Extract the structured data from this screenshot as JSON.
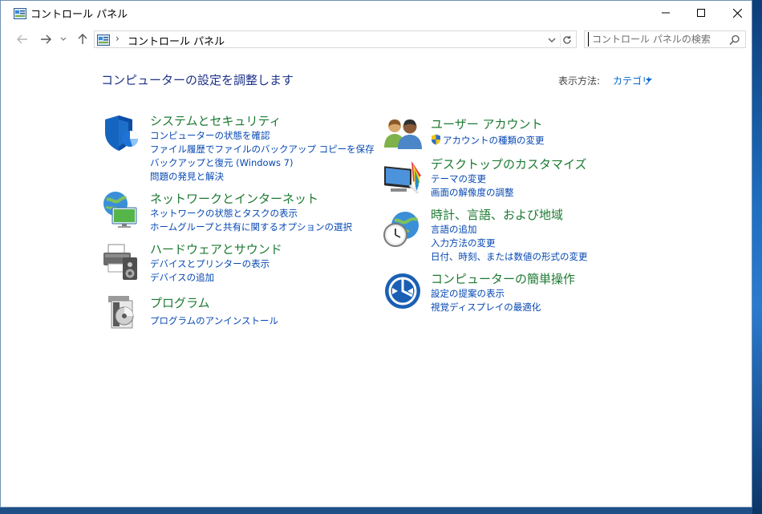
{
  "window": {
    "title": "コントロール パネル"
  },
  "address_bar": {
    "separator": "›",
    "path": "コントロール パネル"
  },
  "search": {
    "placeholder": "コントロール パネルの検索"
  },
  "content": {
    "title": "コンピューターの設定を調整します",
    "view_by_label": "表示方法:",
    "view_by_value": "カテゴリ"
  },
  "categories_left": [
    {
      "title": "システムとセキュリティ",
      "icon": "shield-icon",
      "links": [
        "コンピューターの状態を確認",
        "ファイル履歴でファイルのバックアップ コピーを保存",
        "バックアップと復元 (Windows 7)",
        "問題の発見と解決"
      ]
    },
    {
      "title": "ネットワークとインターネット",
      "icon": "network-globe-icon",
      "links": [
        "ネットワークの状態とタスクの表示",
        "ホームグループと共有に関するオプションの選択"
      ]
    },
    {
      "title": "ハードウェアとサウンド",
      "icon": "printer-speaker-icon",
      "links": [
        "デバイスとプリンターの表示",
        "デバイスの追加"
      ]
    },
    {
      "title": "プログラム",
      "icon": "program-disc-icon",
      "links": [
        "プログラムのアンインストール"
      ]
    }
  ],
  "categories_right": [
    {
      "title": "ユーザー アカウント",
      "icon": "users-icon",
      "links": [
        "アカウントの種類の変更"
      ]
    },
    {
      "title": "デスクトップのカスタマイズ",
      "icon": "monitor-palette-icon",
      "links": [
        "テーマの変更",
        "画面の解像度の調整"
      ]
    },
    {
      "title": "時計、言語、および地域",
      "icon": "clock-globe-icon",
      "links": [
        "言語の追加",
        "入力方法の変更",
        "日付、時刻、または数値の形式の変更"
      ]
    },
    {
      "title": "コンピューターの簡単操作",
      "icon": "ease-of-access-icon",
      "links": [
        "設定の提案の表示",
        "視覚ディスプレイの最適化"
      ]
    }
  ],
  "colors": {
    "category_title": "#1c7a32",
    "link": "#0648b3",
    "page_title": "#1e3287"
  }
}
